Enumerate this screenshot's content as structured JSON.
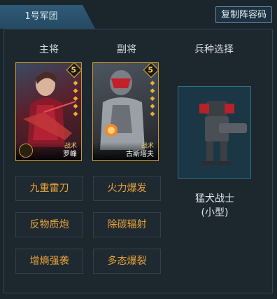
{
  "header": {
    "tab_label": "1号军团",
    "copy_button": "复制阵容码"
  },
  "columns": {
    "main_general": "主将",
    "vice_general": "副将",
    "unit_select": "兵种选择"
  },
  "cards": [
    {
      "star": "5",
      "tag": "战术",
      "name": "罗峰"
    },
    {
      "star": "5",
      "tag": "战术",
      "name": "古斯塔夫"
    }
  ],
  "unit": {
    "name": "猛犬战士",
    "size": "(小型)"
  },
  "skills": [
    "九重雷刀",
    "火力爆发",
    "反物质炮",
    "除碳辐射",
    "增熵强袭",
    "多态爆裂"
  ],
  "colors": {
    "accent": "#e8a33a",
    "card_border": "#c79a2f",
    "tab": "#2f5a76"
  }
}
